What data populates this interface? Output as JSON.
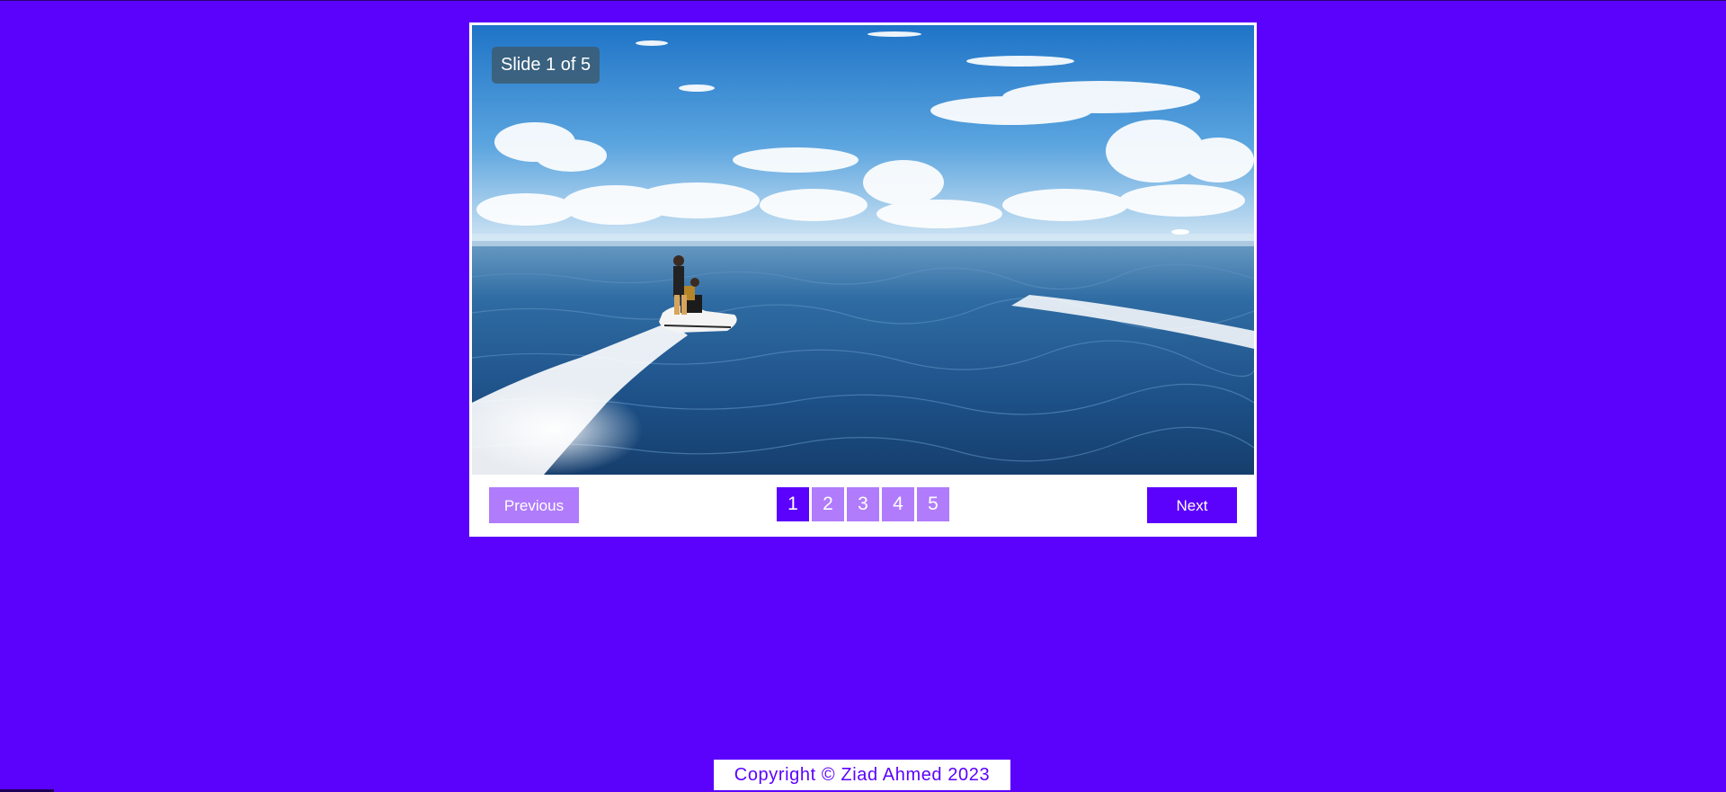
{
  "slider": {
    "counter_text": "Slide 1 of 5",
    "current_slide": 1,
    "total_slides": 5,
    "image_icon": "jet-ski-ocean-photo",
    "prev_label": "Previous",
    "next_label": "Next",
    "pages": [
      "1",
      "2",
      "3",
      "4",
      "5"
    ],
    "active_page_index": 0
  },
  "footer": {
    "copyright": "Copyright © Ziad Ahmed 2023"
  },
  "colors": {
    "background": "#5b02fd",
    "accent": "#5b02fd",
    "inactive": "#b07cfb",
    "panel": "#ffffff"
  }
}
